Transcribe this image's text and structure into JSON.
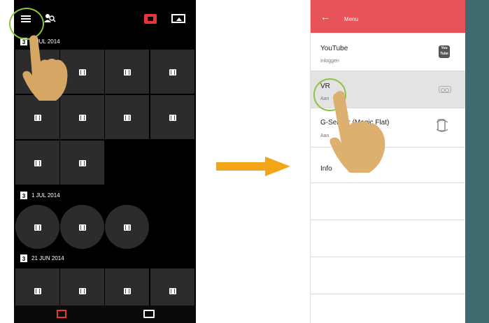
{
  "left_screen": {
    "dates": [
      {
        "day": "3",
        "label": "4 JUL 2014"
      },
      {
        "day": "3",
        "label": "1 JUL 2014"
      },
      {
        "day": "3",
        "label": "21 JUN 2014"
      }
    ],
    "icons": {
      "menu": "hamburger-icon",
      "people": "people-icon",
      "camera": "camera-icon",
      "gallery": "image-icon",
      "video_tab": "film-icon",
      "image_tab": "image-icon"
    },
    "colors": {
      "accent": "#e8353b",
      "highlight_ring": "#8ac43f",
      "tile": "#2c2c2c"
    }
  },
  "right_screen": {
    "header": {
      "back": "←",
      "title": "Menu"
    },
    "items": [
      {
        "title": "YouTube",
        "subtitle": "Inloggen",
        "icon": "youtube-icon"
      },
      {
        "title": "VR",
        "subtitle": "Aan",
        "icon": "vr-headset-icon"
      },
      {
        "title": "G-Sensor (Magic Flat)",
        "subtitle": "Aan",
        "icon": "g-sensor-icon"
      },
      {
        "title": "Info",
        "subtitle": "",
        "icon": ""
      }
    ],
    "youtube_icon_text": "You Tube",
    "colors": {
      "header": "#e8535a",
      "overlay": "#3d6b6f",
      "selected": "#e3e3e3"
    }
  }
}
